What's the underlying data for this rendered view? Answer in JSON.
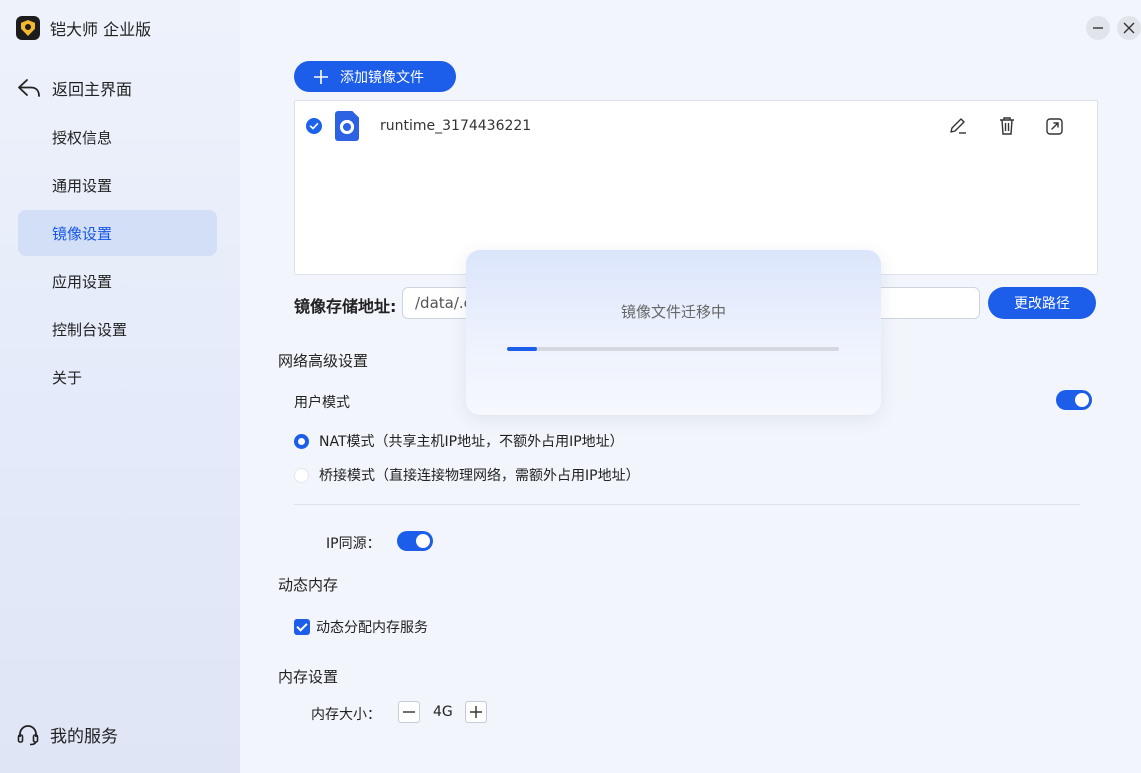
{
  "app": {
    "title": "铠大师 企业版"
  },
  "sidebar": {
    "back_label": "返回主界面",
    "items": [
      {
        "label": "授权信息",
        "active": false
      },
      {
        "label": "通用设置",
        "active": false
      },
      {
        "label": "镜像设置",
        "active": true
      },
      {
        "label": "应用设置",
        "active": false
      },
      {
        "label": "控制台设置",
        "active": false
      },
      {
        "label": "关于",
        "active": false
      }
    ],
    "service_label": "我的服务"
  },
  "window_controls": {
    "minimize_icon": "minimize-icon",
    "close_icon": "close-icon"
  },
  "images": {
    "add_label": "添加镜像文件",
    "files": [
      {
        "name": "runtime_3174436221",
        "checked": true
      }
    ],
    "row_actions": [
      "edit-icon",
      "trash-icon",
      "export-icon"
    ]
  },
  "storage": {
    "label": "镜像存储地址",
    "colon": ":",
    "path_value": "/data/.c",
    "change_label": "更改路径"
  },
  "network": {
    "title": "网络高级设置",
    "user_mode_label": "用户模式",
    "user_mode_on": true,
    "nat_label": "NAT模式（共享主机IP地址，不额外占用IP地址）",
    "nat_selected": true,
    "bridge_label": "桥接模式（直接连接物理网络，需额外占用IP地址）",
    "bridge_selected": false,
    "ip_source_label": "IP同源：",
    "ip_source_on": true
  },
  "dynamic_memory": {
    "title": "动态内存",
    "checkbox_label": "动态分配内存服务",
    "checked": true
  },
  "memory": {
    "title": "内存设置",
    "size_label": "内存大小：",
    "value": "4G"
  },
  "modal": {
    "message": "镜像文件迁移中",
    "progress_percent": 9
  },
  "colors": {
    "accent": "#1c5de9",
    "active_nav_bg": "#d3def7"
  }
}
